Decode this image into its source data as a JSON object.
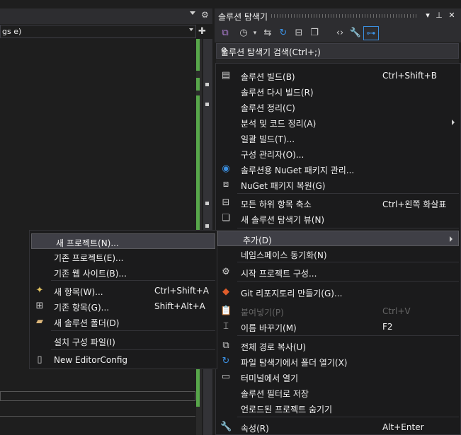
{
  "editor": {
    "combo_text": "gs e)"
  },
  "solution_explorer": {
    "title": "솔루션 탐색기",
    "search_placeholder": "솔루션 탐색기 검색(Ctrl+;)"
  },
  "context_menu": {
    "items": [
      {
        "label": "솔루션 빌드(B)",
        "shortcut": "Ctrl+Shift+B",
        "icon": "build-icon"
      },
      {
        "label": "솔루션 다시 빌드(R)",
        "shortcut": ""
      },
      {
        "label": "솔루션 정리(C)",
        "shortcut": ""
      },
      {
        "label": "분석 및 코드 정리(A)",
        "shortcut": "",
        "submenu": true
      },
      {
        "label": "일괄 빌드(T)...",
        "shortcut": ""
      },
      {
        "label": "구성 관리자(O)...",
        "shortcut": ""
      },
      {
        "label": "솔루션용 NuGet 패키지 관리...",
        "shortcut": "",
        "icon": "nuget-icon"
      },
      {
        "label": "NuGet 패키지 복원(G)",
        "shortcut": "",
        "icon": "nuget-restore-icon"
      },
      {
        "label": "모든 하위 항목 축소",
        "shortcut": "Ctrl+왼쪽 화살표",
        "icon": "collapse-icon"
      },
      {
        "label": "새 솔루션 탐색기 뷰(N)",
        "shortcut": "",
        "icon": "new-view-icon"
      },
      {
        "label": "추가(D)",
        "shortcut": "",
        "submenu": true
      },
      {
        "label": "네임스페이스 동기화(N)",
        "shortcut": ""
      },
      {
        "label": "시작 프로젝트 구성...",
        "shortcut": "",
        "icon": "gear-icon"
      },
      {
        "label": "Git 리포지토리 만들기(G)...",
        "shortcut": "",
        "icon": "git-icon"
      },
      {
        "label": "붙여넣기(P)",
        "shortcut": "Ctrl+V",
        "icon": "paste-icon",
        "disabled": true
      },
      {
        "label": "이름 바꾸기(M)",
        "shortcut": "F2",
        "icon": "rename-icon"
      },
      {
        "label": "전체 경로 복사(U)",
        "shortcut": "",
        "icon": "copy-icon"
      },
      {
        "label": "파일 탐색기에서 폴더 열기(X)",
        "shortcut": "",
        "icon": "refresh-icon"
      },
      {
        "label": "터미널에서 열기",
        "shortcut": "",
        "icon": "terminal-icon"
      },
      {
        "label": "솔루션 필터로 저장",
        "shortcut": ""
      },
      {
        "label": "언로드된 프로젝트 숨기기",
        "shortcut": ""
      },
      {
        "label": "속성(R)",
        "shortcut": "Alt+Enter",
        "icon": "wrench-icon"
      }
    ]
  },
  "add_submenu": {
    "items": [
      {
        "label": "새 프로젝트(N)...",
        "shortcut": ""
      },
      {
        "label": "기존 프로젝트(E)...",
        "shortcut": ""
      },
      {
        "label": "기존 웹 사이트(B)...",
        "shortcut": ""
      },
      {
        "label": "새 항목(W)...",
        "shortcut": "Ctrl+Shift+A",
        "icon": "new-item-icon"
      },
      {
        "label": "기존 항목(G)...",
        "shortcut": "Shift+Alt+A",
        "icon": "existing-item-icon"
      },
      {
        "label": "새 솔루션 폴더(D)",
        "shortcut": "",
        "icon": "folder-icon"
      },
      {
        "label": "설치 구성 파일(I)",
        "shortcut": ""
      },
      {
        "label": "New EditorConfig",
        "shortcut": "",
        "icon": "file-icon"
      }
    ]
  },
  "colors": {
    "accent": "#007acc",
    "menu_bg": "#1b1b1c",
    "highlight": "#3f3f46",
    "diff_green": "#57a64a"
  }
}
